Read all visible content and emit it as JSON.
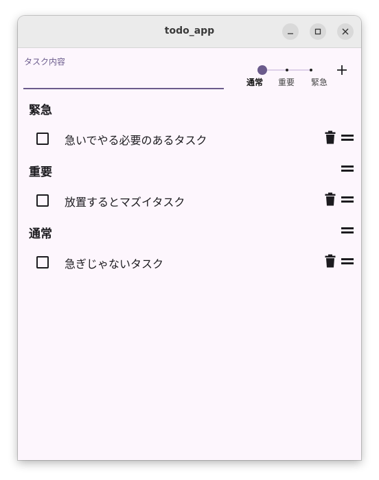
{
  "window": {
    "title": "todo_app",
    "controls": [
      "minimize-icon",
      "maximize-icon",
      "close-icon"
    ]
  },
  "input": {
    "label": "タスク内容",
    "value": ""
  },
  "priority_slider": {
    "options": [
      "通常",
      "重要",
      "緊急"
    ],
    "selected": "通常"
  },
  "add_button": {
    "icon": "plus-icon"
  },
  "sections": [
    {
      "title": "緊急",
      "tasks": [
        {
          "text": "急いでやる必要のあるタスク",
          "done": false
        }
      ]
    },
    {
      "title": "重要",
      "tasks": [
        {
          "text": "放置するとマズイタスク",
          "done": false
        }
      ]
    },
    {
      "title": "通常",
      "tasks": [
        {
          "text": "急ぎじゃないタスク",
          "done": false
        }
      ]
    }
  ],
  "colors": {
    "accent": "#6b5b8c",
    "background": "#fdf6fd",
    "titlebar": "#ebebeb",
    "text": "#1c1b1f"
  }
}
